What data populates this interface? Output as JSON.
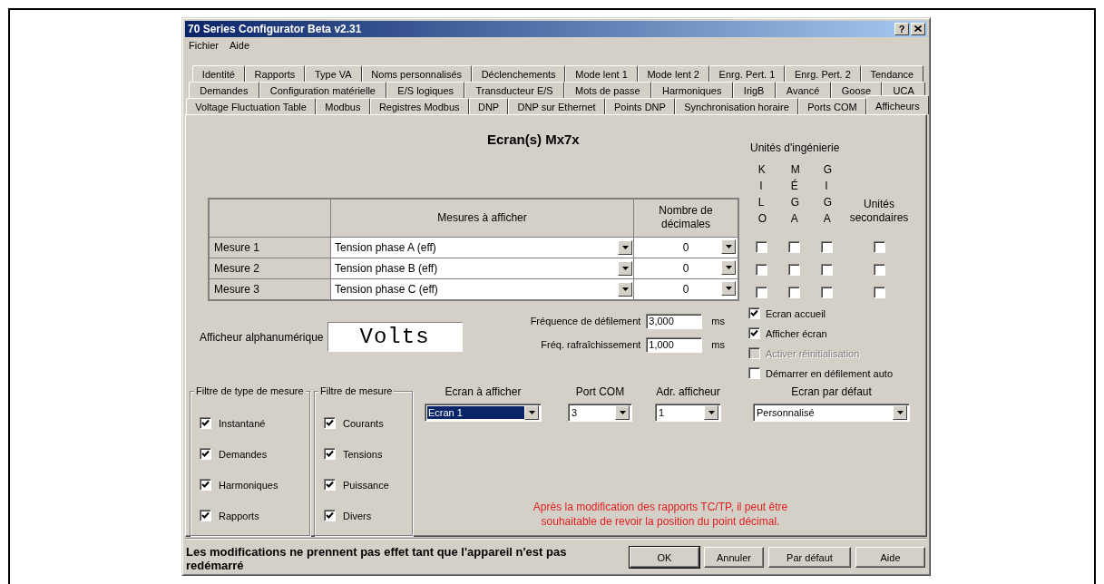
{
  "window": {
    "title": "70 Series Configurator Beta v2.31",
    "help_button": "?"
  },
  "menu": [
    "Fichier",
    "Aide"
  ],
  "tab_rows": [
    {
      "tabs": [
        {
          "label": "Identité",
          "selected": false
        },
        {
          "label": "Rapports",
          "selected": false
        },
        {
          "label": "Type VA",
          "selected": false
        },
        {
          "label": "Noms personnalisés",
          "selected": false
        },
        {
          "label": "Déclenchements",
          "selected": false
        },
        {
          "label": "Mode lent 1",
          "selected": false
        },
        {
          "label": "Mode lent 2",
          "selected": false
        },
        {
          "label": "Enrg. Pert. 1",
          "selected": false
        },
        {
          "label": "Enrg. Pert. 2",
          "selected": false
        },
        {
          "label": "Tendance",
          "selected": false
        }
      ]
    },
    {
      "tabs": [
        {
          "label": "Demandes",
          "selected": false
        },
        {
          "label": "Configuration matérielle",
          "selected": false
        },
        {
          "label": "E/S logiques",
          "selected": false
        },
        {
          "label": "Transducteur E/S",
          "selected": false
        },
        {
          "label": "Mots de passe",
          "selected": false
        },
        {
          "label": "Harmoniques",
          "selected": false
        },
        {
          "label": "IrigB",
          "selected": false
        },
        {
          "label": "Avancé",
          "selected": false
        },
        {
          "label": "Goose",
          "selected": false
        },
        {
          "label": "UCA",
          "selected": false
        }
      ]
    },
    {
      "tabs": [
        {
          "label": "Voltage Fluctuation Table",
          "selected": false
        },
        {
          "label": "Modbus",
          "selected": false
        },
        {
          "label": "Registres Modbus",
          "selected": false
        },
        {
          "label": "DNP",
          "selected": false
        },
        {
          "label": "DNP sur Ethernet",
          "selected": false
        },
        {
          "label": "Points DNP",
          "selected": false
        },
        {
          "label": "Synchronisation horaire",
          "selected": false
        },
        {
          "label": "Ports COM",
          "selected": false
        },
        {
          "label": "Afficheurs",
          "selected": true
        }
      ]
    }
  ],
  "heading": "Ecran(s) Mx7x",
  "table": {
    "columns": [
      "Mesures à afficher",
      "Nombre de décimales"
    ],
    "rows": [
      {
        "label": "Mesure 1",
        "measure": "Tension phase A (eff)",
        "decimals": "0",
        "kilo": false,
        "mega": false,
        "giga": false,
        "secondary": false
      },
      {
        "label": "Mesure 2",
        "measure": "Tension phase B (eff)",
        "decimals": "0",
        "kilo": false,
        "mega": false,
        "giga": false,
        "secondary": false
      },
      {
        "label": "Mesure 3",
        "measure": "Tension phase C (eff)",
        "decimals": "0",
        "kilo": false,
        "mega": false,
        "giga": false,
        "secondary": false
      }
    ]
  },
  "engineering_units": {
    "title": "Unités d'ingénierie",
    "columns": [
      "KILO",
      "MÉGA",
      "GIGA"
    ],
    "secondary": "Unités secondaires"
  },
  "options": [
    {
      "label": "Ecran accueil",
      "checked": true,
      "disabled": false
    },
    {
      "label": "Afficher écran",
      "checked": true,
      "disabled": false
    },
    {
      "label": "Activer réinitialisation",
      "checked": false,
      "disabled": true
    },
    {
      "label": "Démarrer en défilement auto",
      "checked": false,
      "disabled": false
    }
  ],
  "alphanumeric": {
    "label": "Afficheur alphanumérique",
    "value": "Volts"
  },
  "timings": [
    {
      "label": "Fréquence de défilement",
      "value": "3,000",
      "unit": "ms"
    },
    {
      "label": "Fréq. rafraîchissement",
      "value": "1,000",
      "unit": "ms"
    }
  ],
  "filter_groups": [
    {
      "title": "Filtre de type de mesure",
      "items": [
        {
          "label": "Instantané",
          "checked": true
        },
        {
          "label": "Demandes",
          "checked": true
        },
        {
          "label": "Harmoniques",
          "checked": true
        },
        {
          "label": "Rapports",
          "checked": true
        }
      ]
    },
    {
      "title": "Filtre de mesure",
      "items": [
        {
          "label": "Courants",
          "checked": true
        },
        {
          "label": "Tensions",
          "checked": true
        },
        {
          "label": "Puissance",
          "checked": true
        },
        {
          "label": "Divers",
          "checked": true
        }
      ]
    }
  ],
  "selectors": [
    {
      "label": "Ecran à afficher",
      "value": "Ecran 1",
      "focused": true
    },
    {
      "label": "Port COM",
      "value": "3",
      "focused": false
    },
    {
      "label": "Adr. afficheur",
      "value": "1",
      "focused": false
    },
    {
      "label": "Ecran par défaut",
      "value": "Personnalisé",
      "focused": false
    }
  ],
  "note": "Après la modification des rapports TC/TP, il peut être\nsouhaitable de revoir la position du point décimal.",
  "status_message": "Les modifications ne prennent pas effet tant que l'appareil n'est pas redémarré",
  "buttons": [
    {
      "label": "OK",
      "default": true
    },
    {
      "label": "Annuler",
      "default": false
    },
    {
      "label": "Par défaut",
      "default": false
    },
    {
      "label": "Aide",
      "default": false
    }
  ]
}
